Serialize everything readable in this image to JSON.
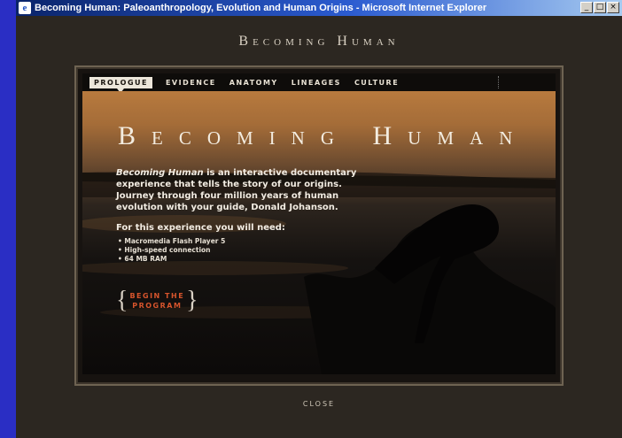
{
  "window": {
    "title": "Becoming Human: Paleoanthropology, Evolution and Human Origins - Microsoft Internet Explorer",
    "controls": {
      "minimize": "_",
      "maximize": "□",
      "close": "×"
    }
  },
  "header": {
    "title": "Becoming Human"
  },
  "nav": {
    "items": [
      {
        "label": "PROLOGUE"
      },
      {
        "label": "EVIDENCE"
      },
      {
        "label": "ANATOMY"
      },
      {
        "label": "LINEAGES"
      },
      {
        "label": "CULTURE"
      }
    ]
  },
  "hero": {
    "title": "Becoming Human",
    "intro_emphasis": "Becoming Human",
    "intro_rest": " is an interactive documentary experience that tells the story of our origins. Journey through four million years of human evolution with your guide, Donald Johanson.",
    "requirements_title": "For this experience you will need:",
    "requirements": [
      "Macromedia Flash Player 5",
      "High-speed connection",
      "64 MB RAM"
    ],
    "begin_line1": "BEGIN THE",
    "begin_line2": "PROGRAM"
  },
  "footer": {
    "close_label": "CLOSE"
  },
  "colors": {
    "accent": "#d6542c",
    "background": "#2c2721",
    "titlebar": "#0a246a"
  }
}
